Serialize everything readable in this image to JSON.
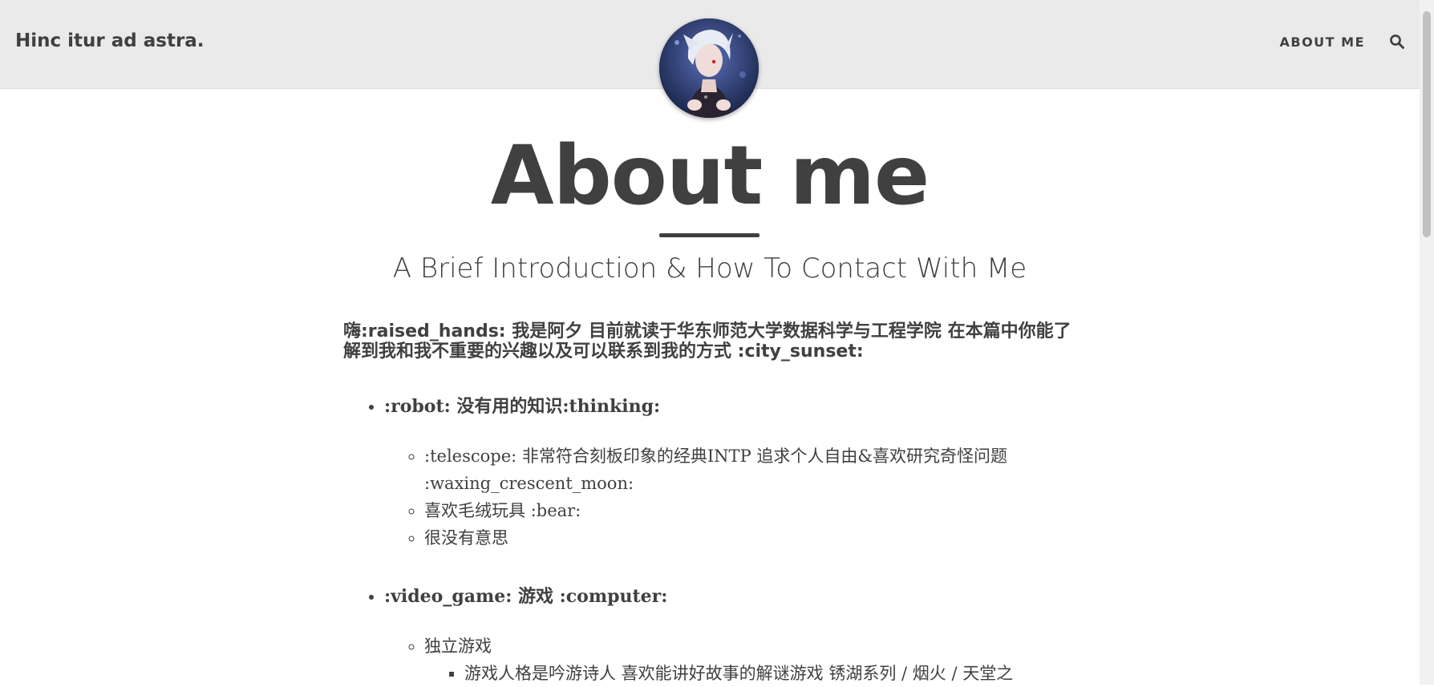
{
  "nav": {
    "brand": "Hinc itur ad astra.",
    "about_label": "ABOUT ME",
    "search_icon": "search-icon"
  },
  "avatar": {
    "icon": "avatar-image"
  },
  "header": {
    "title": "About me",
    "subtitle": "A Brief Introduction & How To Contact With Me"
  },
  "content": {
    "intro": "嗨:raised_hands: 我是阿夕 目前就读于华东师范大学数据科学与工程学院 在本篇中你能了解到我和我不重要的兴趣以及可以联系到我的方式 :city_sunset:",
    "sections": [
      {
        "heading": ":robot: 没有用的知识:thinking:",
        "items": [
          ":telescope: 非常符合刻板印象的经典INTP 追求个人自由&喜欢研究奇怪问题 :waxing_crescent_moon:",
          "喜欢毛绒玩具 :bear:",
          "很没有意思"
        ]
      },
      {
        "heading": ":video_game: 游戏 :computer:",
        "items": [
          "独立游戏"
        ],
        "subitems": [
          "游戏人格是吟游诗人 喜欢能讲好故事的解谜游戏 锈湖系列 / 烟火 / 天堂之"
        ]
      }
    ]
  },
  "colors": {
    "navbar_bg": "#eaeaea",
    "text": "#404040",
    "page_bg": "#ffffff"
  }
}
